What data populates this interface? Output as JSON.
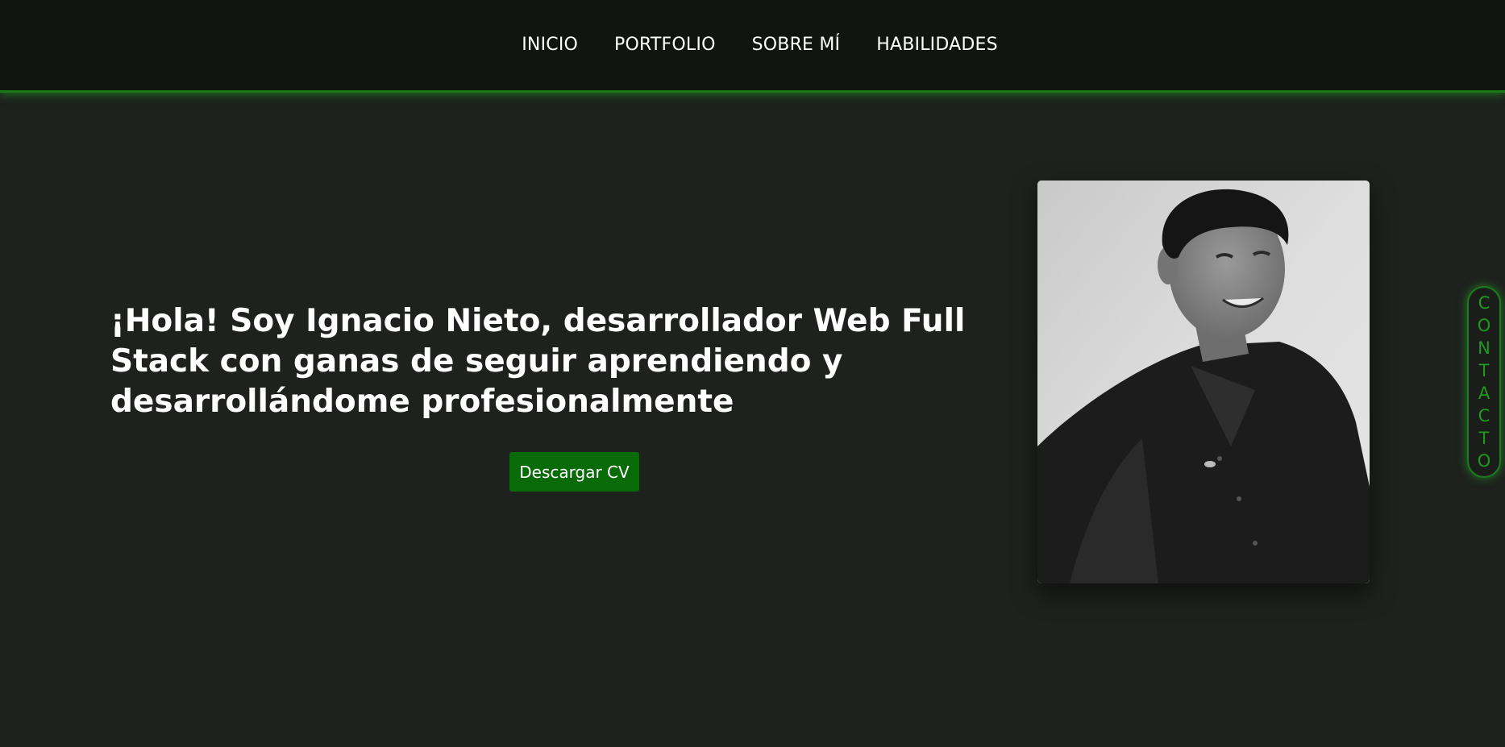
{
  "nav": {
    "items": [
      {
        "label": "INICIO"
      },
      {
        "label": "PORTFOLIO"
      },
      {
        "label": "SOBRE MÍ"
      },
      {
        "label": "HABILIDADES"
      }
    ]
  },
  "hero": {
    "headline": "¡Hola! Soy Ignacio Nieto, desarrollador Web Full Stack con ganas de seguir aprendiendo y desarrollándome profesionalmente",
    "cv_button_label": "Descargar CV"
  },
  "contact_tab": {
    "letters": [
      "C",
      "O",
      "N",
      "T",
      "A",
      "C",
      "T",
      "O"
    ]
  },
  "colors": {
    "background": "#1e211e",
    "navbar": "#111411",
    "accent_green": "#086b08",
    "glow_green": "#1f9a1f"
  }
}
